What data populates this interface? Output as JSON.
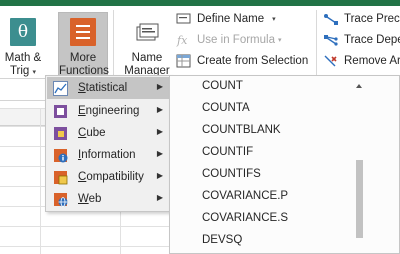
{
  "ribbon": {
    "math_trig": {
      "line1": "Math &",
      "line2": "Trig",
      "icon": "theta-function-icon"
    },
    "more_functions": {
      "line1": "More",
      "line2": "Functions",
      "icon": "more-functions-icon"
    },
    "name_manager": {
      "line1": "Name",
      "line2": "Manager",
      "icon": "name-manager-icon"
    },
    "define_name": "Define Name",
    "use_in_formula": "Use in Formula",
    "create_from_selection": "Create from Selection",
    "trace_precedents": "Trace Prece",
    "trace_dependents": "Trace Depe",
    "remove_arrows": "Remove Ar"
  },
  "category_menu": {
    "items": [
      {
        "label": "Statistical",
        "underline": "S",
        "rest": "tatistical",
        "icon": "statistical-icon",
        "selected": true
      },
      {
        "label": "Engineering",
        "underline": "E",
        "rest": "ngineering",
        "icon": "engineering-icon",
        "selected": false
      },
      {
        "label": "Cube",
        "underline": "C",
        "rest": "ube",
        "icon": "cube-icon",
        "selected": false
      },
      {
        "label": "Information",
        "underline": "I",
        "rest": "nformation",
        "icon": "information-icon",
        "selected": false
      },
      {
        "label": "Compatibility",
        "underline": "C",
        "rest": "ompatibility",
        "icon": "compatibility-icon",
        "selected": false
      },
      {
        "label": "Web",
        "underline": "W",
        "rest": "eb",
        "icon": "web-icon",
        "selected": false
      }
    ]
  },
  "function_list": {
    "items": [
      "COUNT",
      "COUNTA",
      "COUNTBLANK",
      "COUNTIF",
      "COUNTIFS",
      "COVARIANCE.P",
      "COVARIANCE.S",
      "DEVSQ"
    ]
  },
  "colors": {
    "excel_green": "#217346",
    "selected_bg": "#c5c5c5",
    "menu_bg": "#f0f0f0"
  }
}
